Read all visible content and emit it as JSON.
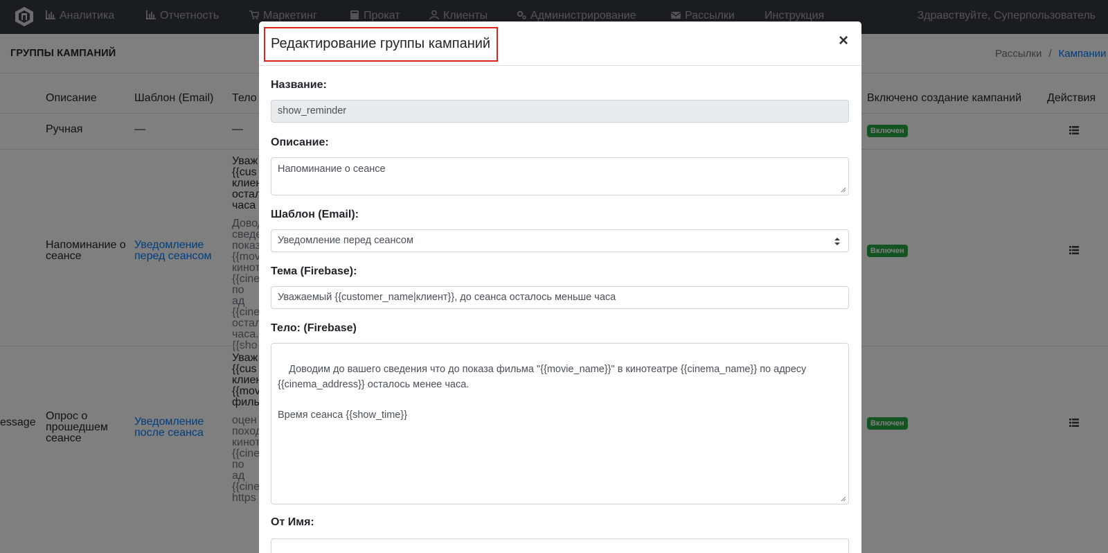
{
  "navbar": {
    "items": [
      {
        "label": "Аналитика",
        "icon": "bar-chart-icon"
      },
      {
        "label": "Отчетность",
        "icon": "bar-chart-icon"
      },
      {
        "label": "Маркетинг",
        "icon": "cart-icon"
      },
      {
        "label": "Прокат",
        "icon": "book-icon"
      },
      {
        "label": "Клиенты",
        "icon": "user-icon"
      },
      {
        "label": "Администрирование",
        "icon": "cogs-icon"
      },
      {
        "label": "Рассылки",
        "icon": "envelope-icon"
      },
      {
        "label": "Инструкция",
        "icon": ""
      }
    ],
    "greeting": "Здравствуйте, Суперпользователь"
  },
  "page": {
    "title": "ГРУППЫ КАМПАНИЙ",
    "breadcrumb": {
      "home": "Рассылки",
      "separator": "/",
      "active": "Кампании"
    }
  },
  "table": {
    "headers": {
      "description": "Описание",
      "template": "Шаблон (Email)",
      "body": "Тело",
      "enabled": "Включено создание кампаний",
      "actions": "Действия"
    },
    "rows": [
      {
        "name": "",
        "description": "Ручная",
        "template": "—",
        "body_title": "—",
        "body_lines": [],
        "status": "Включен"
      },
      {
        "name": "",
        "description": "Напоминание о сеансе",
        "template": "Уведомление перед сеансом",
        "body_title": [
          "Уваж",
          "{{cus",
          "клиен",
          "остал",
          "часа"
        ],
        "body_lines": [
          "Довод",
          "сведе",
          "показ",
          "{{mov",
          "кинот",
          "{{cine",
          "по ад",
          "{{cine",
          "остал",
          "часа.",
          "{{sho"
        ],
        "status": "Включен"
      },
      {
        "name": "essage",
        "description": "Опрос о прошедшем сеансе",
        "template": "Уведомление после сеанса",
        "body_title": [
          "Уваж",
          "{{cus",
          "клиен",
          "{{mov",
          "филь"
        ],
        "body_lines": [
          "оцен",
          "поход",
          "кинот",
          "{{cine",
          "по ад",
          "{{cine",
          "https"
        ],
        "status": "Включен"
      }
    ]
  },
  "modal": {
    "title": "Редактирование группы кампаний",
    "close_symbol": "×",
    "fields": {
      "name": {
        "label": "Название:",
        "value": "show_reminder"
      },
      "description": {
        "label": "Описание:",
        "value": "Напоминание о сеансе"
      },
      "template": {
        "label": "Шаблон (Email):",
        "value": "Уведомление перед сеансом"
      },
      "subject": {
        "label": "Тема (Firebase):",
        "value": "Уважаемый {{customer_name|клиент}}, до сеанса осталось меньше часа"
      },
      "body": {
        "label": "Тело: (Firebase)",
        "value": "Доводим до вашего сведения что до показа фильма \"{{movie_name}}\" в кинотеатре {{cinema_name}} по адресу {{cinema_address}} осталось менее часа.\n\nВремя сеанса {{show_time}}"
      },
      "from_name": {
        "label": "От Имя:",
        "value": ""
      }
    }
  },
  "colors": {
    "navbar": "#343a40",
    "accent": "#007bff",
    "success": "#28a745",
    "highlight": "#e0201b"
  }
}
